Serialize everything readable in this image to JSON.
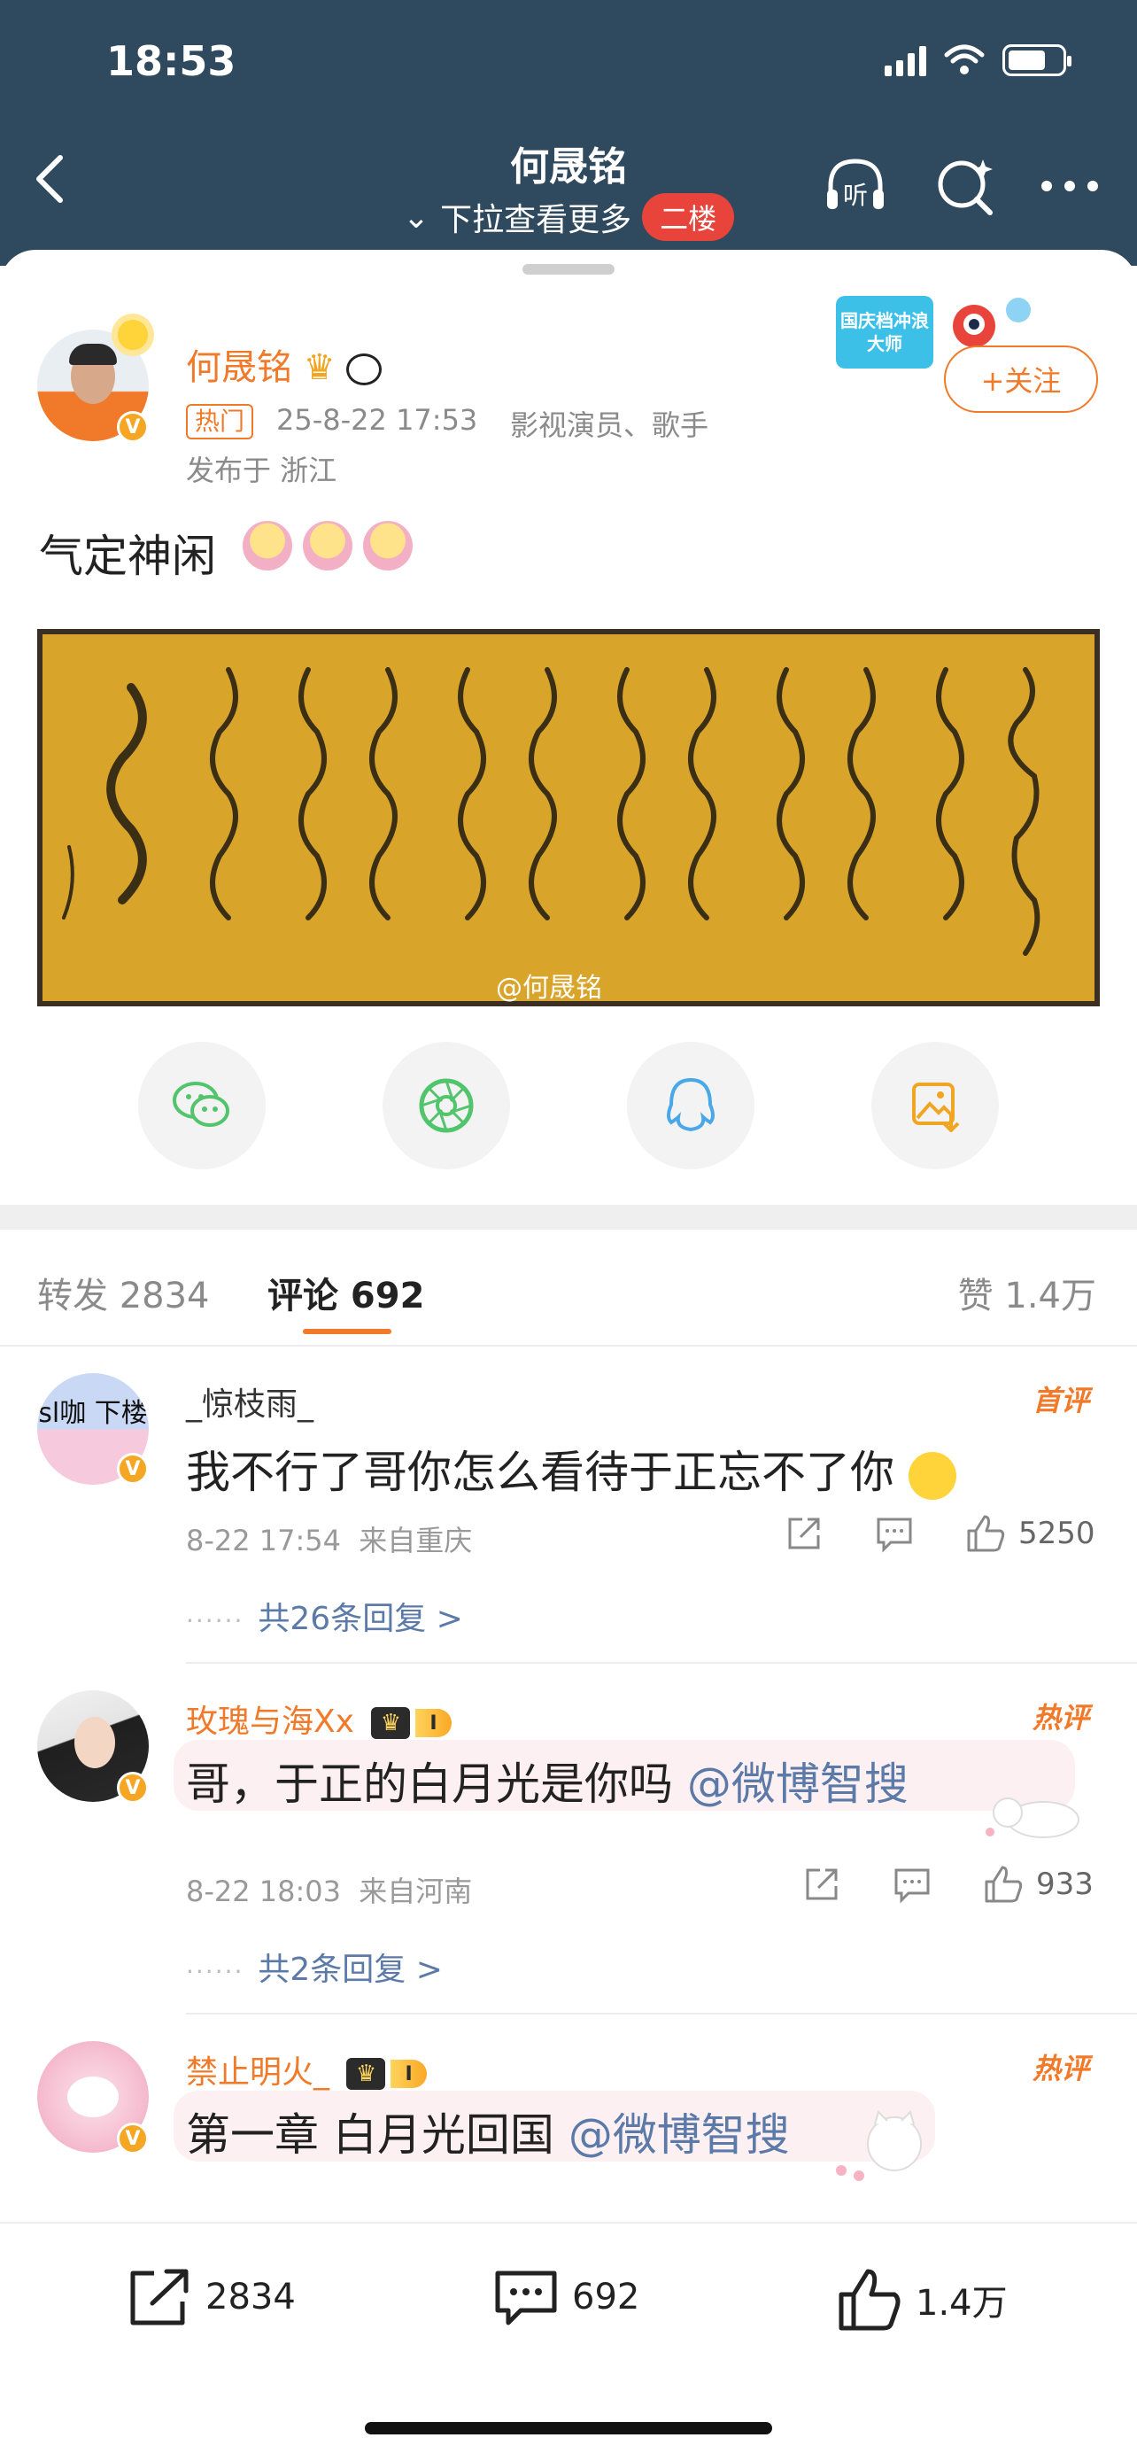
{
  "status": {
    "time": "18:53"
  },
  "header": {
    "title": "何晟铭",
    "subtitle": "下拉查看更多",
    "floor_badge": "二楼",
    "listen_label": "听"
  },
  "post": {
    "author": "何晟铭",
    "hot_tag": "热门",
    "time": "25-8-22 17:53",
    "source": "影视演员、歌手",
    "location": "发布于 浙江",
    "follow_label": "+关注",
    "promo_label": "国庆档冲浪大师",
    "text": "气定神闲",
    "watermark": "@何晟铭"
  },
  "share_targets": [
    "wechat-icon",
    "moments-icon",
    "qq-icon",
    "save-image-icon"
  ],
  "tabs": {
    "repost": "转发 2834",
    "comments": "评论 692",
    "likes": "赞 1.4万"
  },
  "comments": [
    {
      "avatar_text": "sl咖 下楼",
      "name": "_惊枝雨_",
      "tag": "首评",
      "text": "我不行了哥你怎么看待于正忘不了你",
      "time": "8-22 17:54",
      "from": "来自重庆",
      "likes": "5250",
      "replies": "共26条回复 >"
    },
    {
      "name": "玫瑰与海Xx",
      "tag": "热评",
      "level": "I",
      "text": "哥，于正的白月光是你吗",
      "mention": "@微博智搜",
      "time": "8-22 18:03",
      "from": "来自河南",
      "likes": "933",
      "replies": "共2条回复 >"
    },
    {
      "name": "禁止明火_",
      "tag": "热评",
      "level": "I",
      "text": "第一章 白月光回国",
      "mention": "@微博智搜"
    }
  ],
  "bottom_bar": {
    "repost": "2834",
    "comment": "692",
    "like": "1.4万"
  },
  "colors": {
    "header_bg": "#2f4a5e",
    "accent": "#f07a2a",
    "mention": "#5b7aa8",
    "badge_red": "#e8443b"
  }
}
